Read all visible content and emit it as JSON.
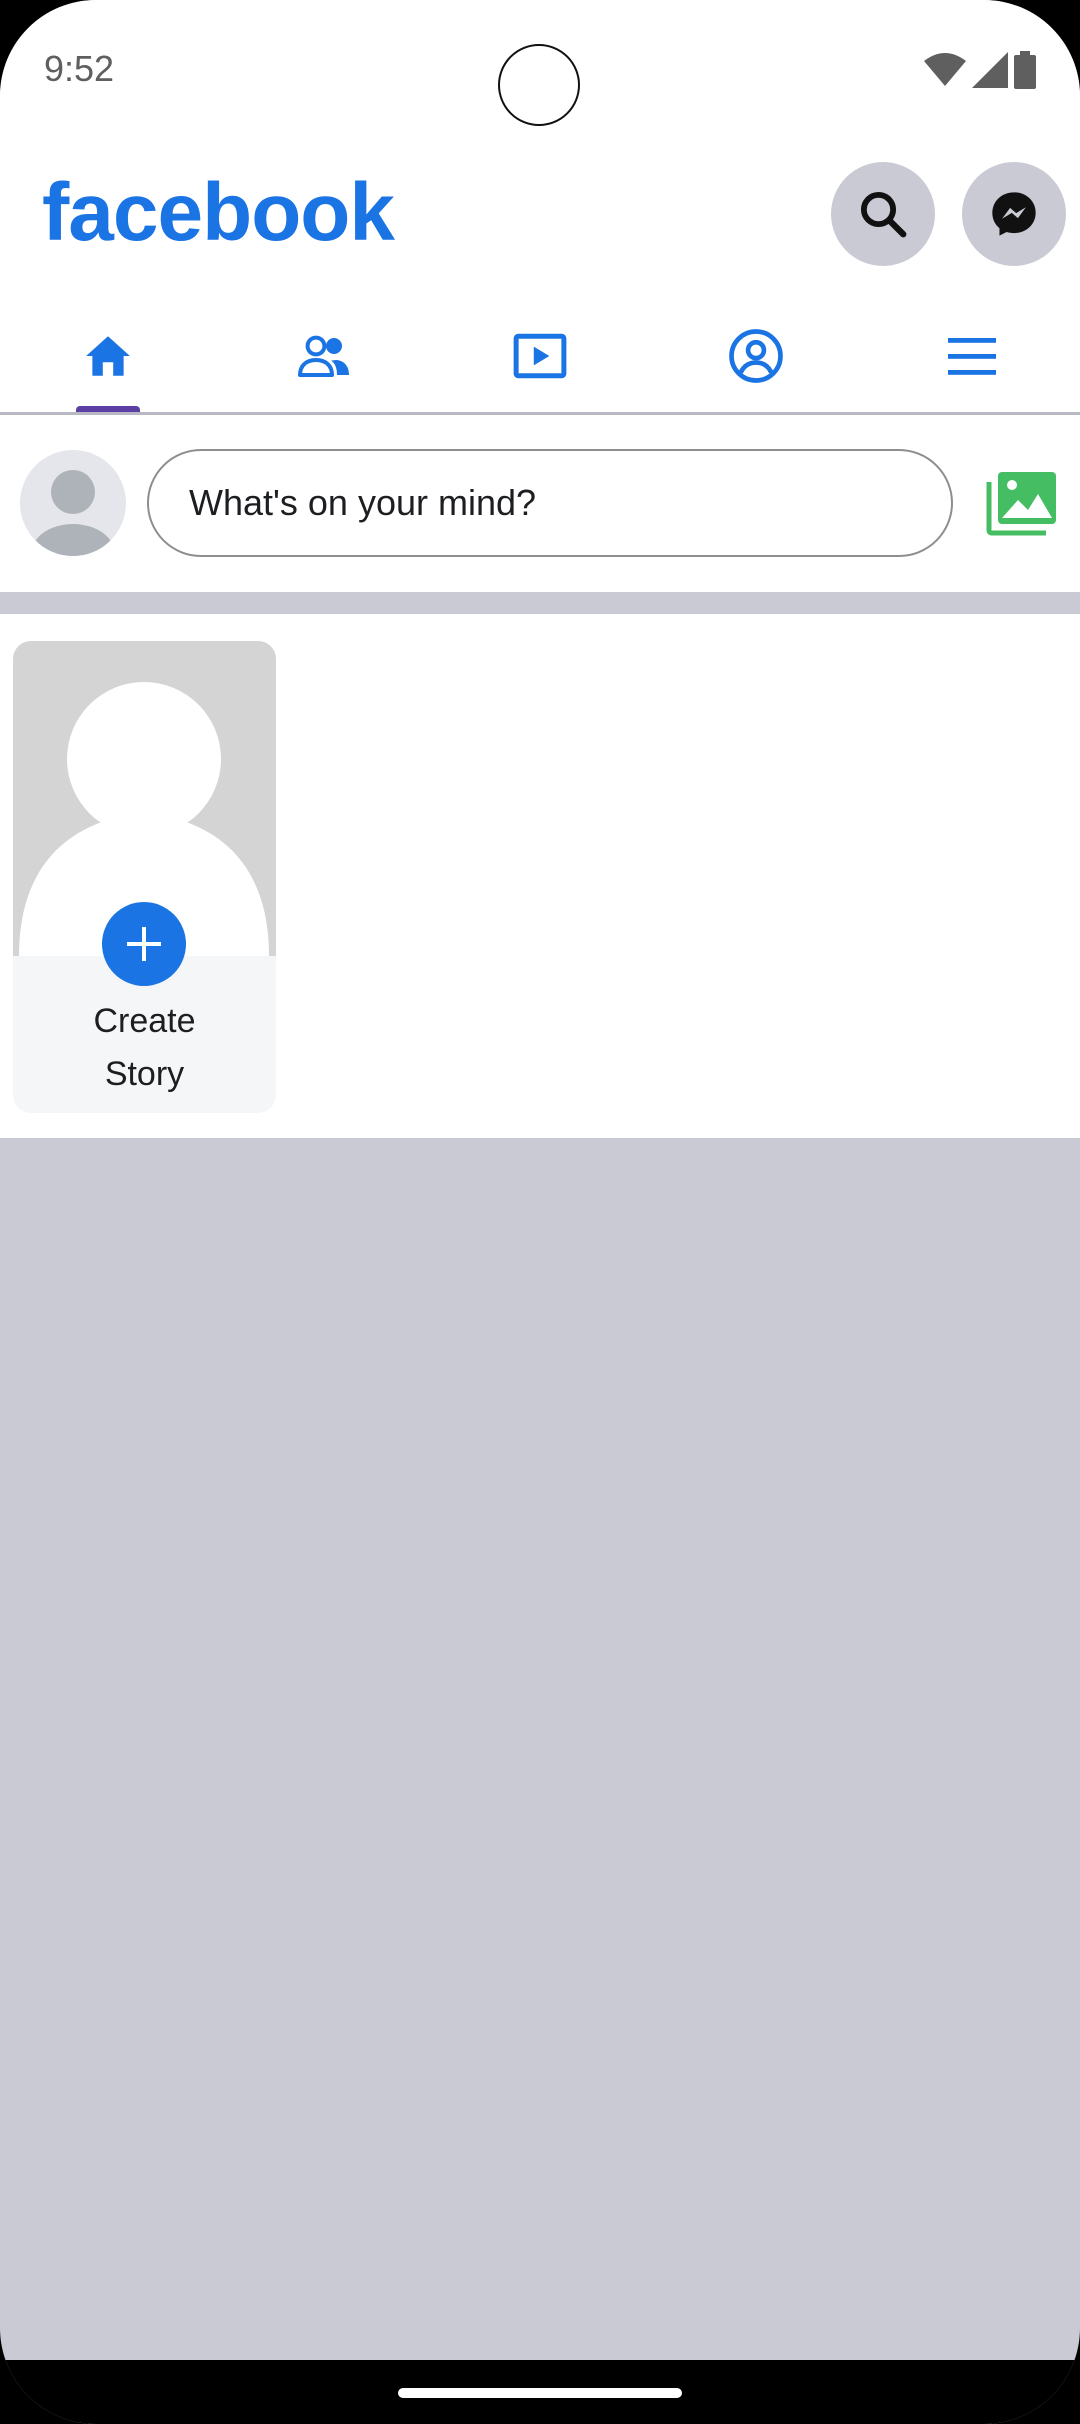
{
  "status_bar": {
    "time": "9:52",
    "icons": [
      "wifi-icon",
      "cell-signal-icon",
      "battery-icon"
    ]
  },
  "header": {
    "logo_text": "facebook",
    "brand_color": "#1b74e4",
    "buttons": [
      "search-icon",
      "messenger-icon"
    ]
  },
  "tabs": [
    {
      "name": "home",
      "icon": "home-icon",
      "selected": true
    },
    {
      "name": "friends",
      "icon": "friends-icon",
      "selected": false
    },
    {
      "name": "watch",
      "icon": "video-play-icon",
      "selected": false
    },
    {
      "name": "profile",
      "icon": "profile-circle-icon",
      "selected": false
    },
    {
      "name": "menu",
      "icon": "hamburger-menu-icon",
      "selected": false
    }
  ],
  "composer": {
    "placeholder": "What's on your mind?",
    "photo_icon": "photo-gallery-icon",
    "photo_icon_color": "#45bd62"
  },
  "stories": {
    "create_label": "Create\nStory"
  },
  "colors": {
    "feed_background": "#c9cad3",
    "tab_indicator": "#5b3fa5"
  }
}
